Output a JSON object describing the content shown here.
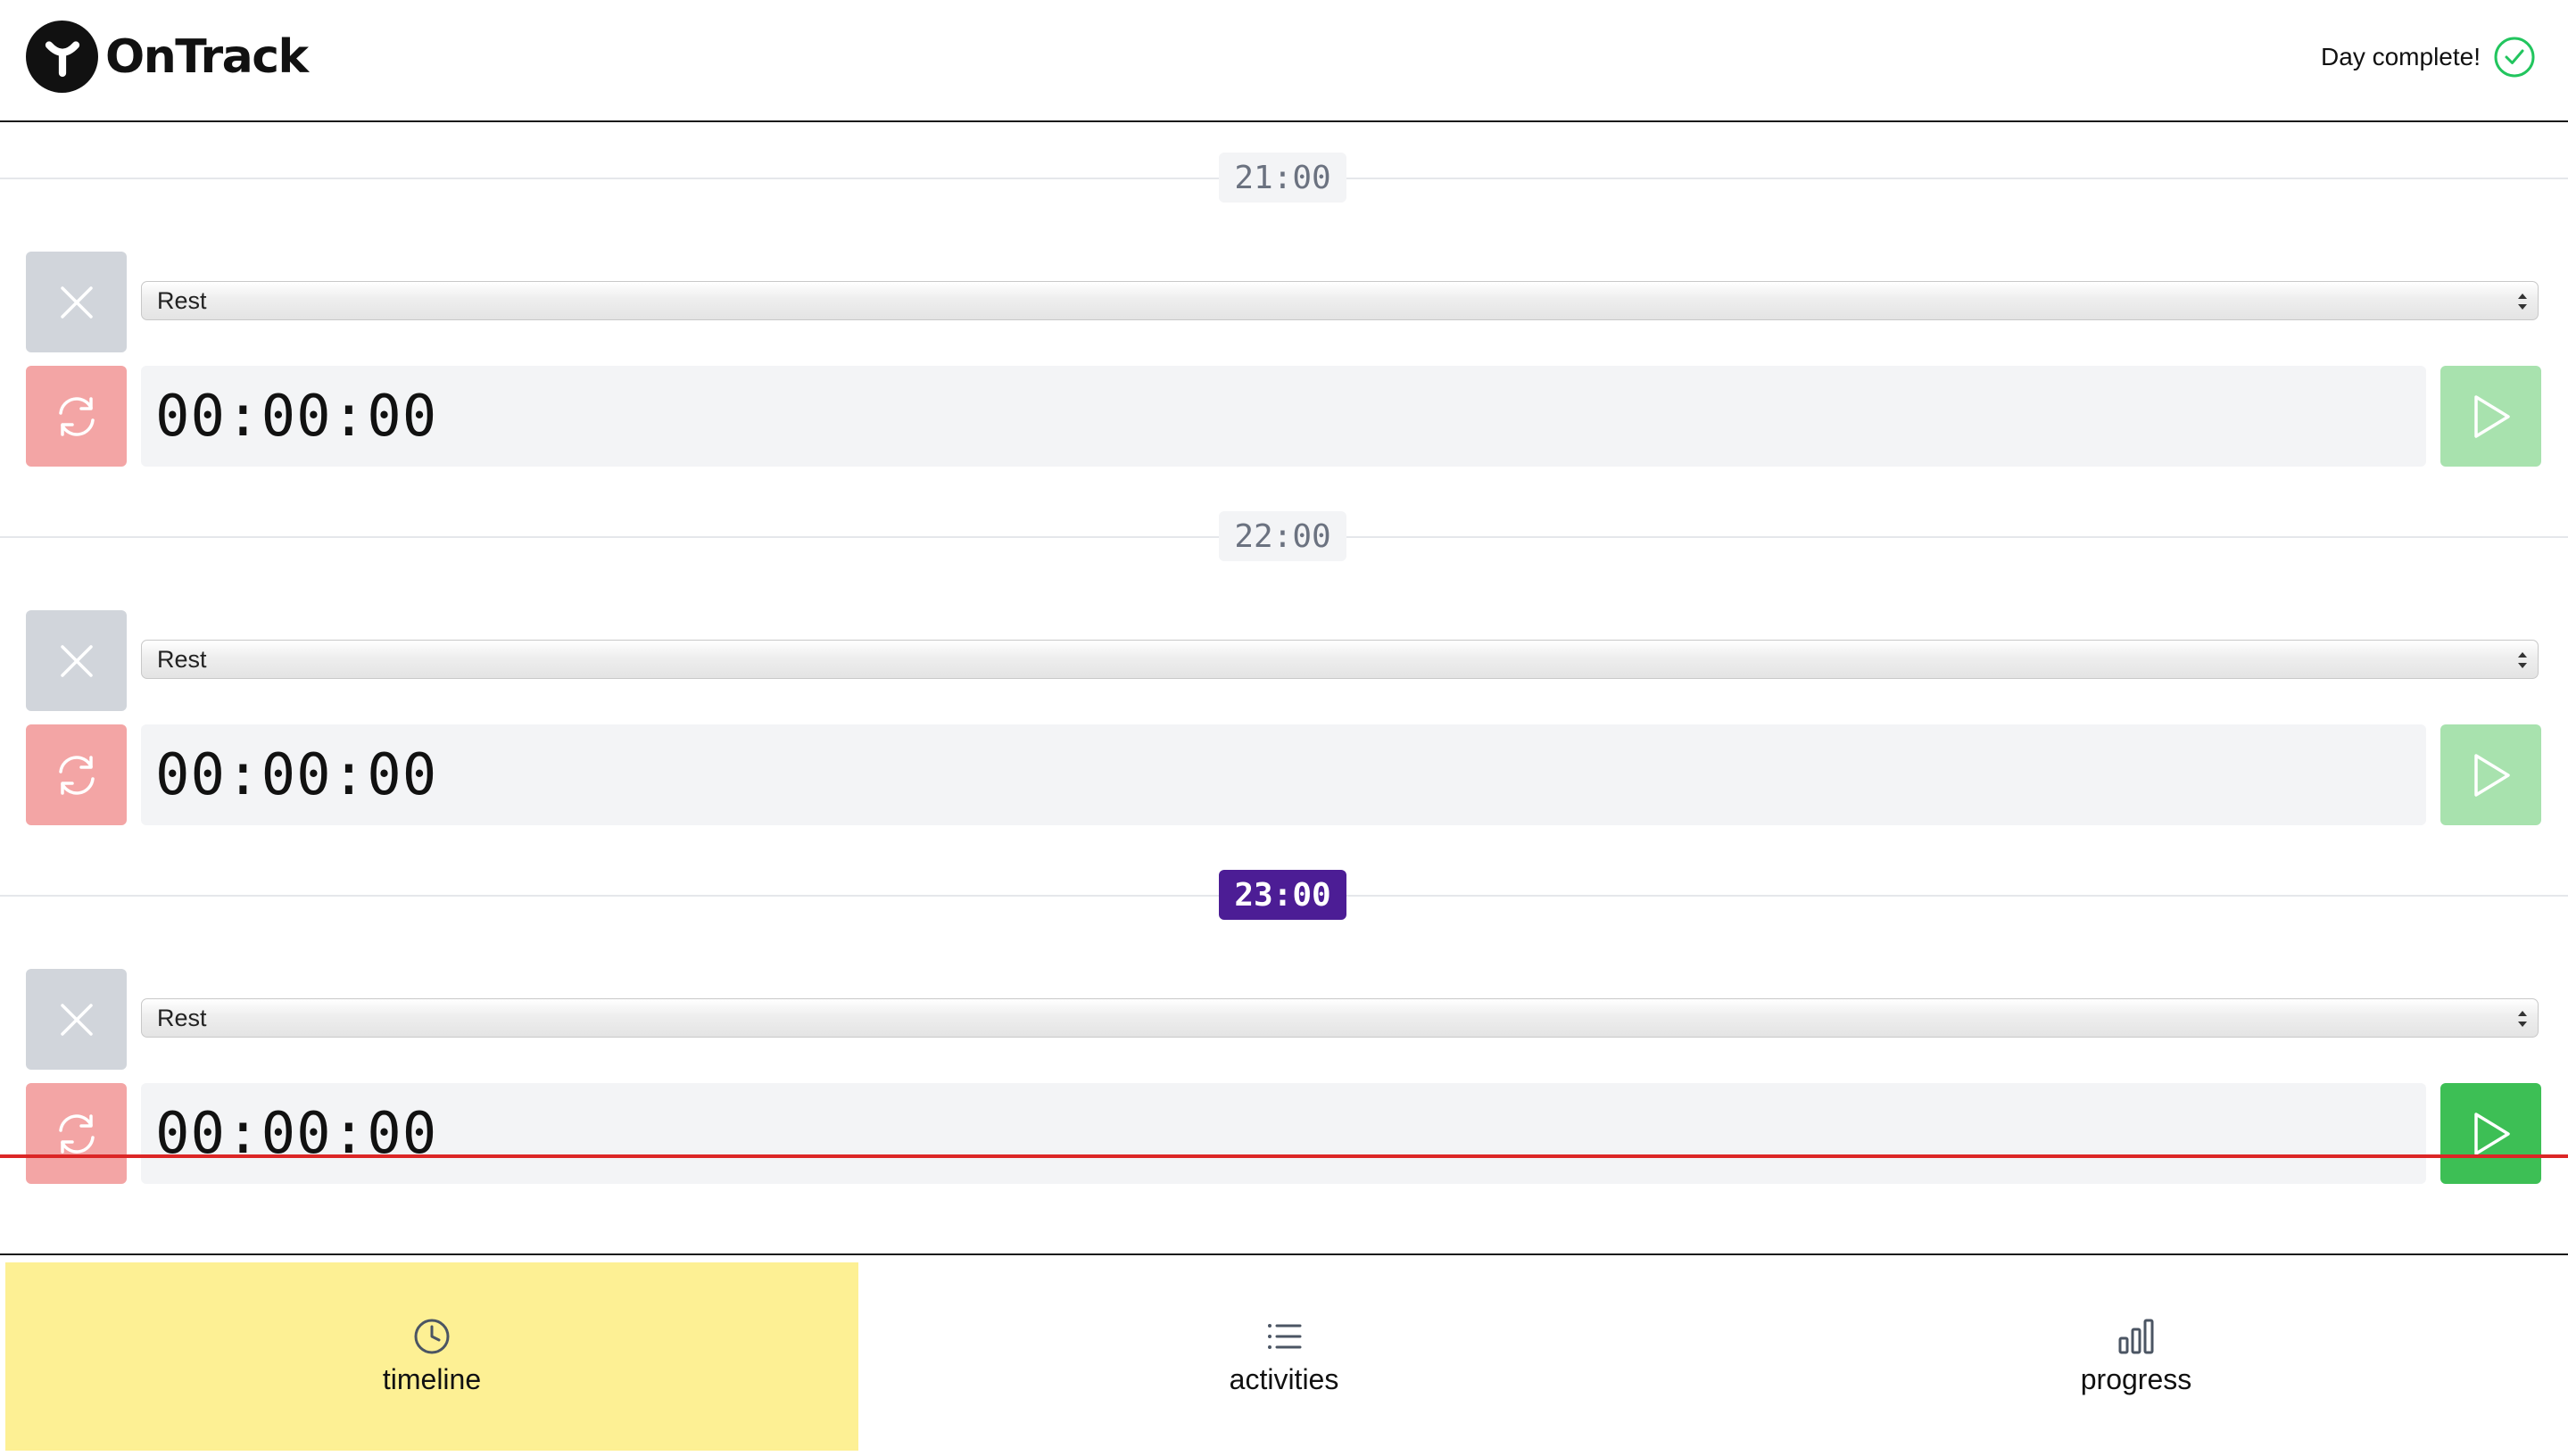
{
  "app": {
    "name": "OnTrack",
    "status_text": "Day complete!"
  },
  "slots": [
    {
      "hour": "21:00",
      "activity": "Rest",
      "timer": "00:00:00",
      "current": false
    },
    {
      "hour": "22:00",
      "activity": "Rest",
      "timer": "00:00:00",
      "current": false
    },
    {
      "hour": "23:00",
      "activity": "Rest",
      "timer": "00:00:00",
      "current": true
    }
  ],
  "nav": {
    "items": [
      {
        "label": "timeline",
        "icon": "clock-icon",
        "active": true
      },
      {
        "label": "activities",
        "icon": "list-icon",
        "active": false
      },
      {
        "label": "progress",
        "icon": "bar-chart-icon",
        "active": false
      }
    ]
  },
  "colors": {
    "current_hour_bg": "#4c1d95",
    "now_line": "#dc2626",
    "play_active": "#3dbf55",
    "active_nav_bg": "#fdf094"
  }
}
